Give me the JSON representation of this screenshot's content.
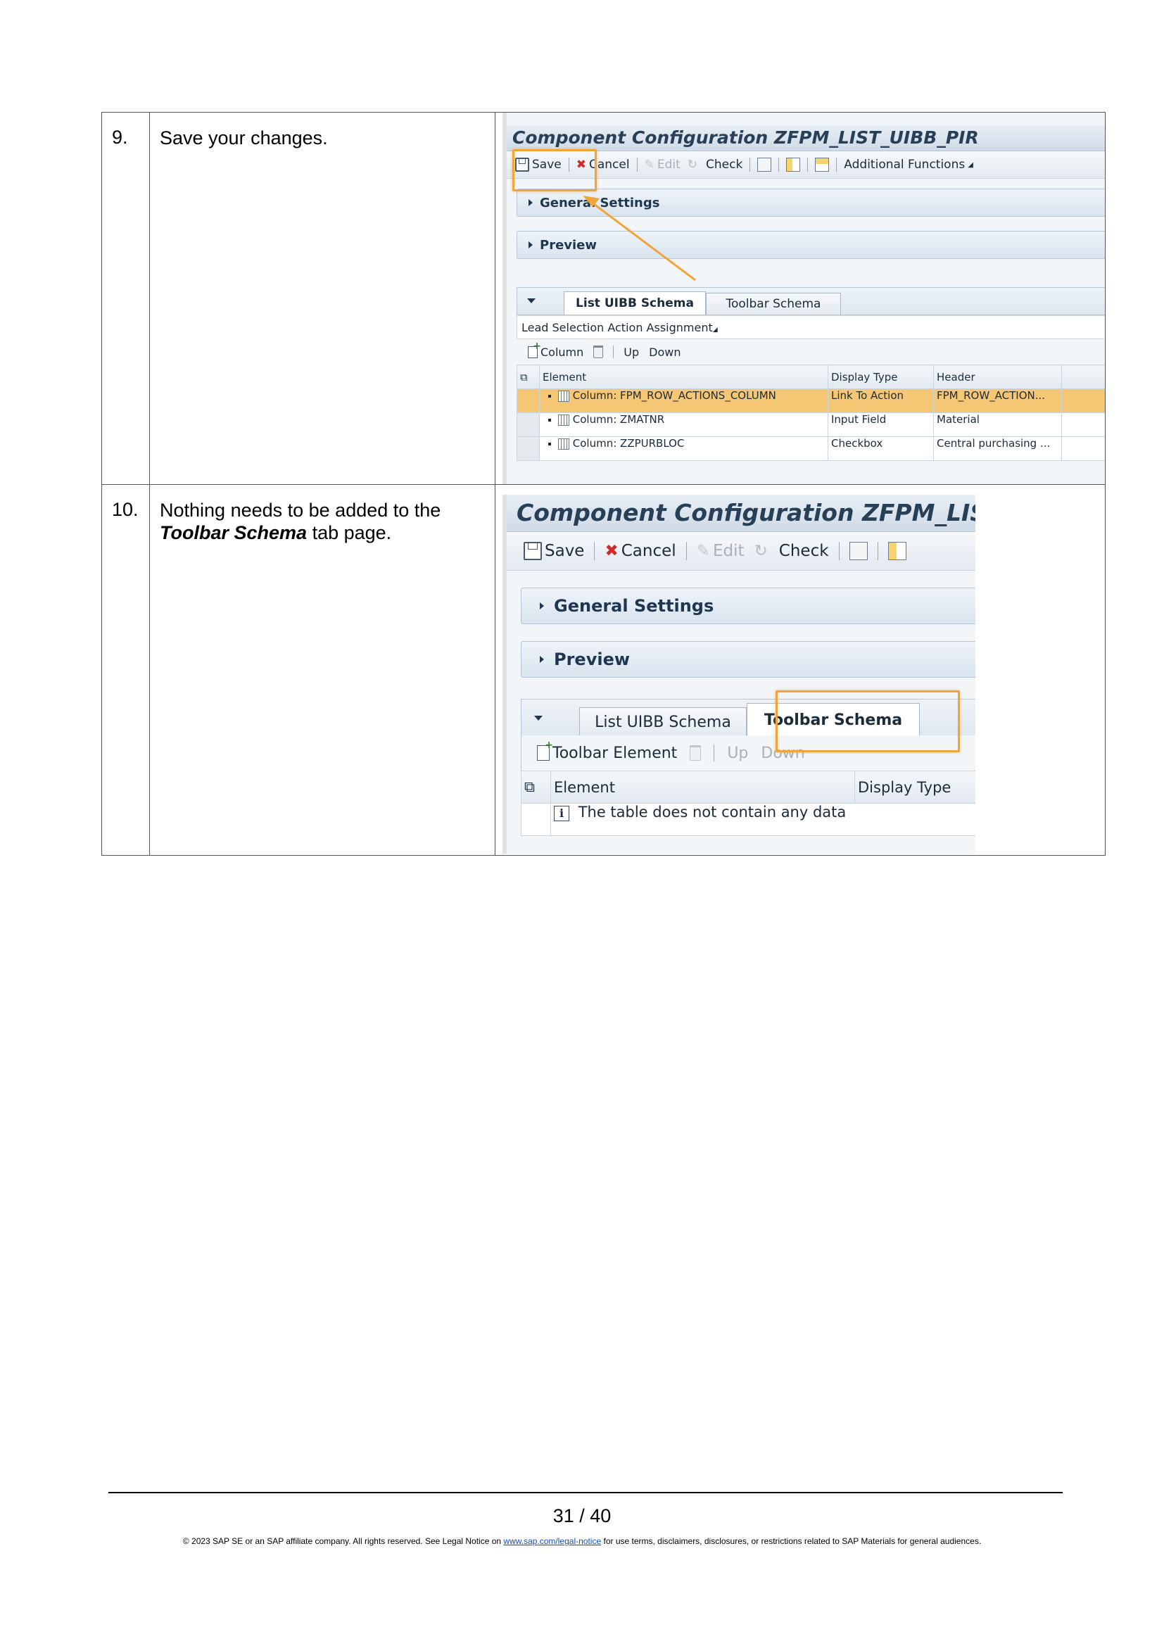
{
  "steps": [
    {
      "number": "9.",
      "text": "Save your changes.",
      "screenshot": {
        "title": "Component Configuration ZFPM_LIST_UIBB_PIR",
        "toolbar": {
          "save": "Save",
          "cancel": "Cancel",
          "edit": "Edit",
          "check": "Check",
          "additional": "Additional Functions"
        },
        "panels": {
          "general": "General Settings",
          "preview": "Preview"
        },
        "tabs": [
          "List UIBB Schema",
          "Toolbar Schema"
        ],
        "lead_selection": "Lead Selection Action Assignment",
        "list_toolbar": {
          "column": "Column",
          "up": "Up",
          "down": "Down"
        },
        "table": {
          "headers": [
            "Element",
            "Display Type",
            "Header"
          ],
          "rows": [
            {
              "element": "Column: FPM_ROW_ACTIONS_COLUMN",
              "display_type": "Link To Action",
              "header": "FPM_ROW_ACTION..."
            },
            {
              "element": "Column: ZMATNR",
              "display_type": "Input Field",
              "header": "Material"
            },
            {
              "element": "Column: ZZPURBLOC",
              "display_type": "Checkbox",
              "header": "Central purchasing ..."
            }
          ]
        }
      }
    },
    {
      "number": "10.",
      "text_before": "Nothing needs to be added to the",
      "text_bold": "Toolbar Schema",
      "text_after": "tab page.",
      "screenshot": {
        "title": "Component Configuration ZFPM_LIST_",
        "toolbar": {
          "save": "Save",
          "cancel": "Cancel",
          "edit": "Edit",
          "check": "Check"
        },
        "panels": {
          "general": "General Settings",
          "preview": "Preview"
        },
        "tabs": [
          "List UIBB Schema",
          "Toolbar Schema"
        ],
        "list_toolbar": {
          "toolbar_element": "Toolbar Element",
          "up": "Up",
          "down": "Down"
        },
        "table": {
          "headers": [
            "Element",
            "Display Type"
          ],
          "empty_message": "The table does not contain any data"
        }
      }
    }
  ],
  "footer": {
    "page": "31 / 40",
    "legal_before": "© 2023 SAP SE or an SAP affiliate company. All rights reserved. See Legal Notice on",
    "legal_link": "www.sap.com/legal-notice",
    "legal_after": "for use terms, disclaimers, disclosures, or restrictions related to SAP Materials for general audiences."
  }
}
